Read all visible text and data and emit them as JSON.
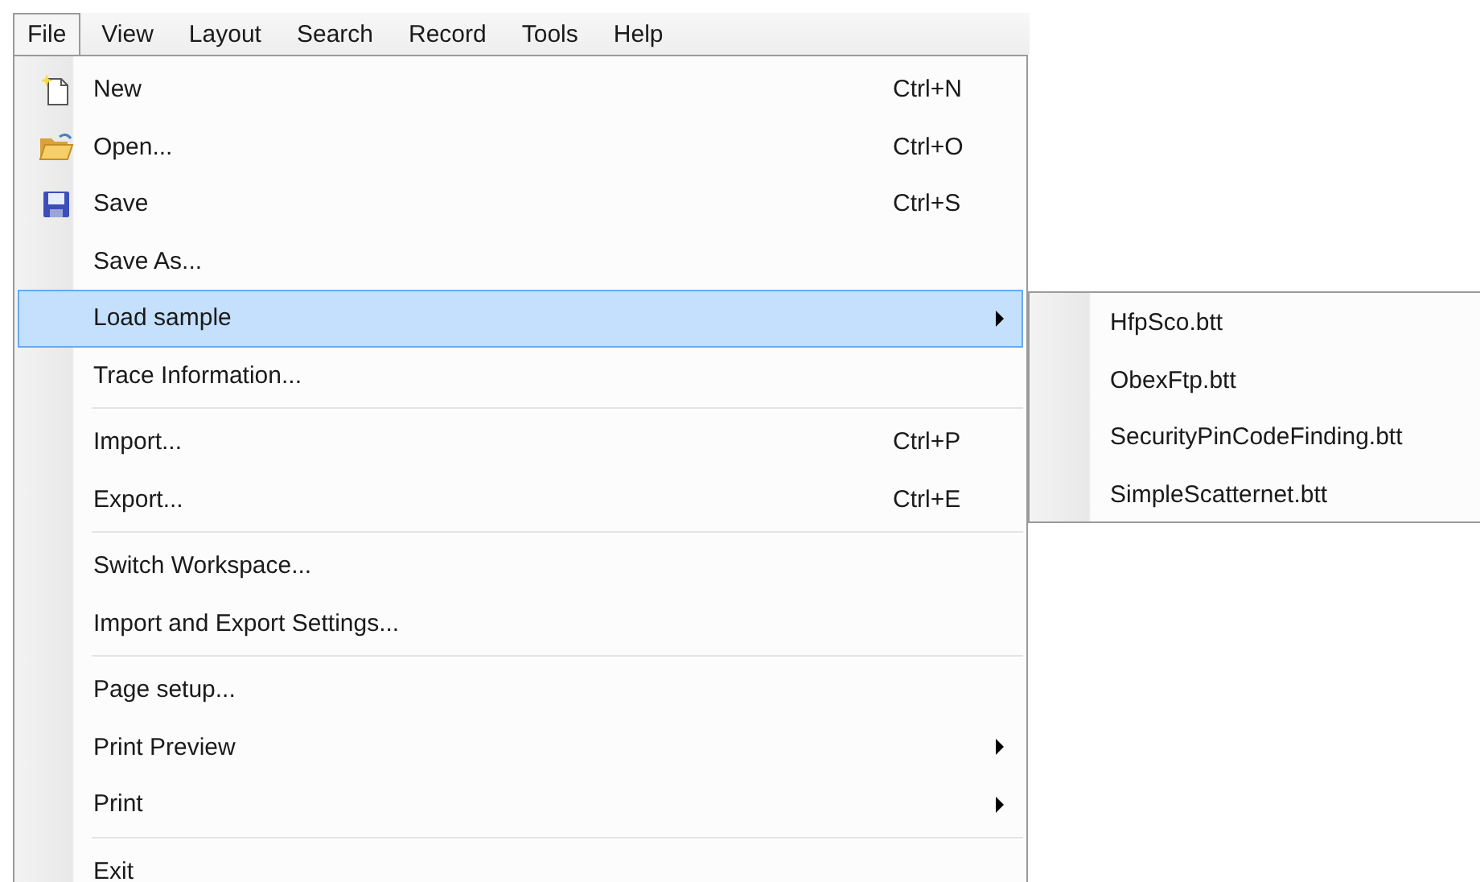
{
  "menu_bar": [
    {
      "label": "File",
      "selected": true
    },
    {
      "label": "View",
      "selected": false
    },
    {
      "label": "Layout",
      "selected": false
    },
    {
      "label": "Search",
      "selected": false
    },
    {
      "label": "Record",
      "selected": false
    },
    {
      "label": "Tools",
      "selected": false
    },
    {
      "label": "Help",
      "selected": false
    }
  ],
  "file_menu": [
    {
      "kind": "item",
      "label": "New",
      "shortcut": "Ctrl+N",
      "submenu": false,
      "selected": false
    },
    {
      "kind": "item",
      "label": "Open...",
      "shortcut": "Ctrl+O",
      "submenu": false,
      "selected": false
    },
    {
      "kind": "item",
      "label": "Save",
      "shortcut": "Ctrl+S",
      "submenu": false,
      "selected": false
    },
    {
      "kind": "item",
      "label": "Save As...",
      "submenu": false,
      "selected": false
    },
    {
      "kind": "item",
      "label": "Load sample",
      "submenu": true,
      "selected": true
    },
    {
      "kind": "item",
      "label": "Trace Information...",
      "submenu": false,
      "selected": false
    },
    {
      "kind": "separator"
    },
    {
      "kind": "item",
      "label": "Import...",
      "shortcut": "Ctrl+P",
      "submenu": false,
      "selected": false
    },
    {
      "kind": "item",
      "label": "Export...",
      "shortcut": "Ctrl+E",
      "submenu": false,
      "selected": false
    },
    {
      "kind": "separator"
    },
    {
      "kind": "item",
      "label": "Switch Workspace...",
      "submenu": false,
      "selected": false
    },
    {
      "kind": "item",
      "label": "Import and Export Settings...",
      "submenu": false,
      "selected": false
    },
    {
      "kind": "separator"
    },
    {
      "kind": "item",
      "label": "Page setup...",
      "submenu": false,
      "selected": false
    },
    {
      "kind": "item",
      "label": "Print Preview",
      "submenu": true,
      "selected": false
    },
    {
      "kind": "item",
      "label": "Print",
      "submenu": true,
      "selected": false
    },
    {
      "kind": "separator"
    },
    {
      "kind": "item",
      "label": "Exit",
      "submenu": false,
      "selected": false
    }
  ],
  "load_sample_submenu": [
    {
      "label": "HfpSco.btt",
      "selected": false
    },
    {
      "label": "ObexFtp.btt",
      "selected": false
    },
    {
      "label": "SecurityPinCodeFinding.btt",
      "selected": false
    },
    {
      "label": "SimpleScatternet.btt",
      "selected": false
    }
  ]
}
